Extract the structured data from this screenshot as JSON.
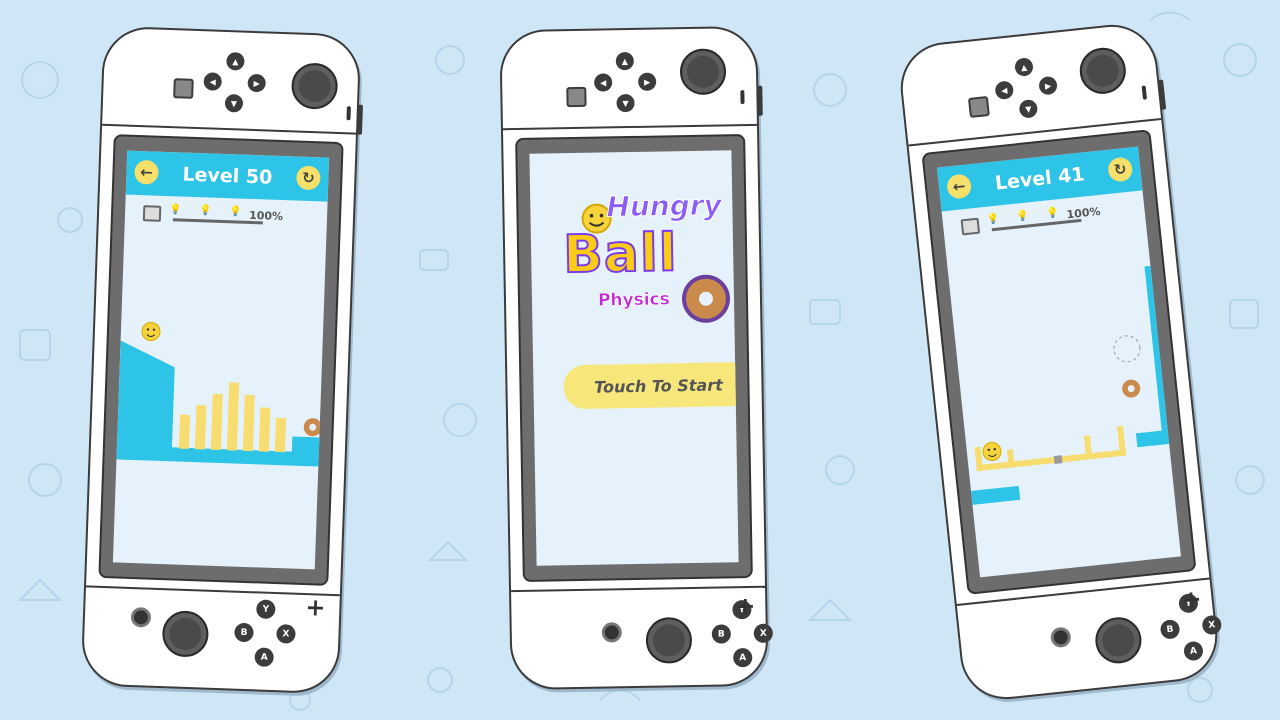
{
  "devices": [
    {
      "id": "left",
      "screen": "level",
      "level_title": "Level 50",
      "progress_label": "100%",
      "progress": 1.0,
      "hints_count": 3
    },
    {
      "id": "center",
      "screen": "title",
      "logo": {
        "word1": "Hungry",
        "word2": "Ball",
        "word3": "Physics"
      },
      "start_label": "Touch To Start"
    },
    {
      "id": "right",
      "screen": "level",
      "level_title": "Level 41",
      "progress_label": "100%",
      "progress": 1.0,
      "hints_count": 3
    }
  ],
  "controller_labels": {
    "y": "Y",
    "x": "X",
    "b": "B",
    "a": "A"
  },
  "colors": {
    "background": "#cfe6f7",
    "topbar": "#2ec4e8",
    "accent_yellow": "#f6e06a",
    "terrain_blue": "#2ec4e8",
    "bars_yellow": "#f7dc6f",
    "donut": "#c98a4b",
    "logo_purple": "#8b5cf6",
    "logo_yellow": "#facc15"
  },
  "icons": [
    "back-arrow-icon",
    "restart-icon",
    "bulb-icon",
    "jar-icon",
    "smiley-ball-icon",
    "donut-icon"
  ]
}
